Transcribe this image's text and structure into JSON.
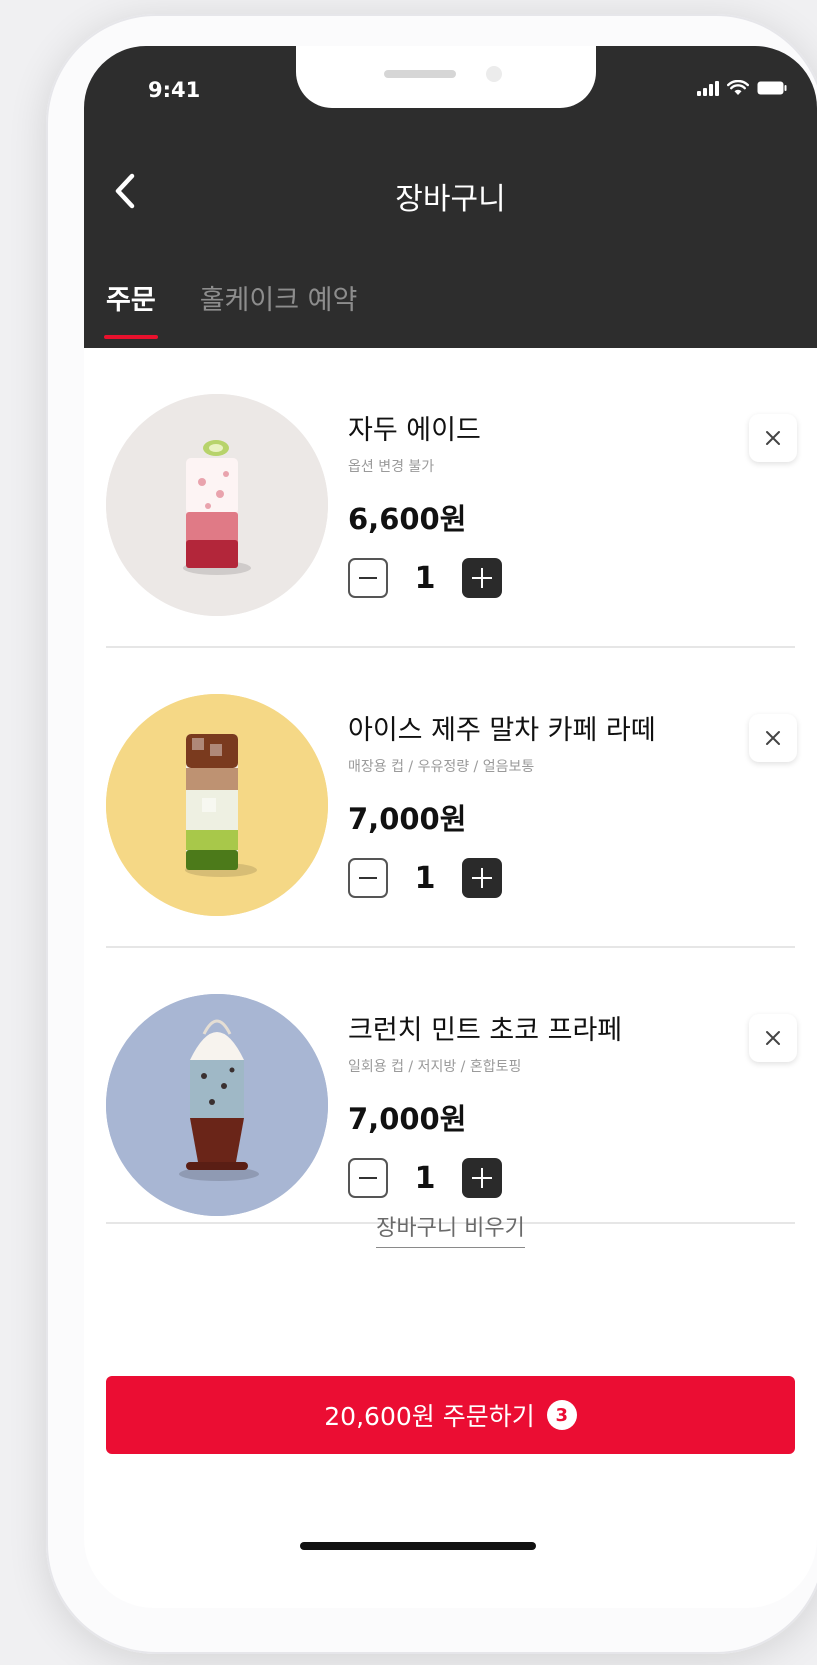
{
  "status_bar": {
    "time": "9:41"
  },
  "header": {
    "title": "장바구니",
    "back_icon": "chevron-left-icon"
  },
  "tabs": [
    {
      "label": "주문",
      "active": true
    },
    {
      "label": "홀케이크 예약",
      "active": false
    }
  ],
  "cart_items": [
    {
      "name": "자두 에이드",
      "options": "옵션 변경 불가",
      "price": "6,600원",
      "quantity": "1",
      "image_bg": "#ece8e6"
    },
    {
      "name": "아이스 제주 말차 카페 라떼",
      "options": "매장용 컵 / 우유정량 / 얼음보통",
      "price": "7,000원",
      "quantity": "1",
      "image_bg": "#f5d886"
    },
    {
      "name": "크런치 민트 초코 프라페",
      "options": "일회용 컵 / 저지방 / 혼합토핑",
      "price": "7,000원",
      "quantity": "1",
      "image_bg": "#a8b6d3"
    }
  ],
  "clear_cart_label": "장바구니 비우기",
  "order_button": {
    "label": "20,600원 주문하기",
    "badge": "3"
  },
  "colors": {
    "header_bg": "#2d2d2d",
    "accent": "#eb0d33",
    "tab_underline": "#e8112d"
  }
}
